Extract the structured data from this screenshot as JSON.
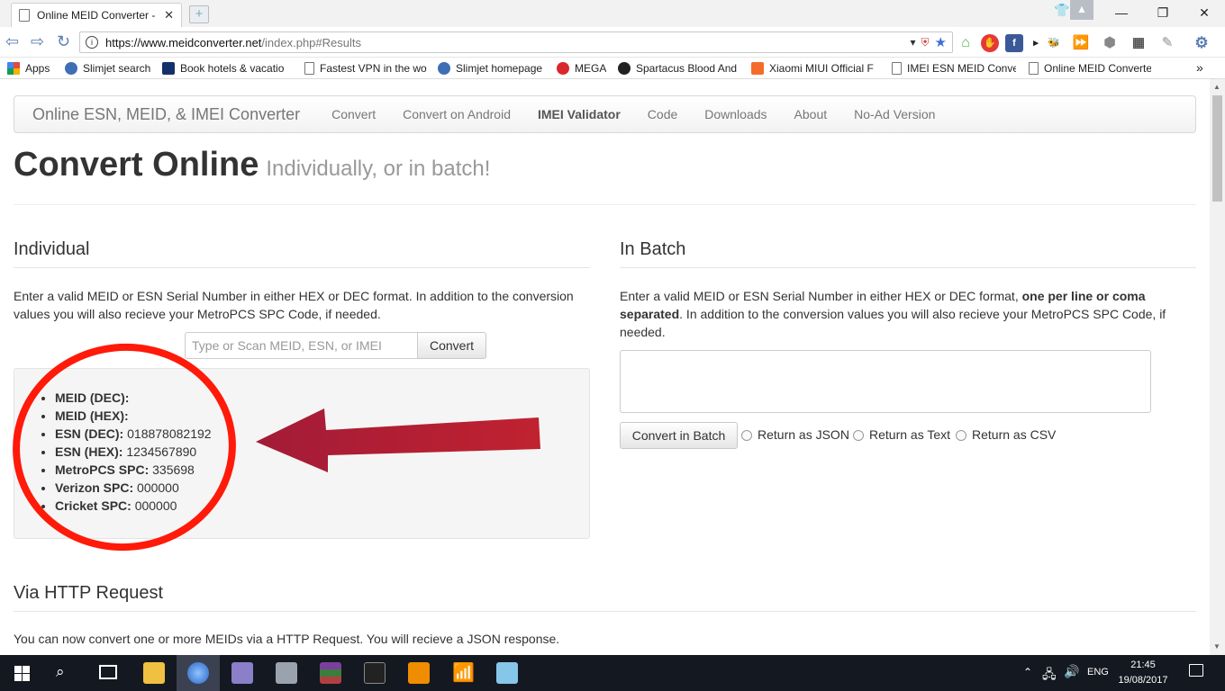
{
  "browser": {
    "tab_title": "Online MEID Converter -",
    "url_host": "https://www.meidconverter.net",
    "url_rest": "/index.php#Results",
    "accent": "#5b7db3"
  },
  "bookmarks": [
    {
      "label": "Apps",
      "color": "#e04a3f"
    },
    {
      "label": "Slimjet search",
      "color": "#3e6fb5"
    },
    {
      "label": "Book hotels & vacatio",
      "color": "#14316b"
    },
    {
      "label": "Fastest VPN in the wo",
      "color": "#ffffff"
    },
    {
      "label": "Slimjet homepage",
      "color": "#3e6fb5"
    },
    {
      "label": "MEGA",
      "color": "#d9272e"
    },
    {
      "label": "Spartacus Blood And",
      "color": "#222222"
    },
    {
      "label": "Xiaomi MIUI Official F",
      "color": "#f56b2a"
    },
    {
      "label": "IMEI ESN MEID Conve",
      "color": "#ffffff"
    },
    {
      "label": "Online MEID Converte",
      "color": "#ffffff"
    }
  ],
  "bookmarks_more": "»",
  "site": {
    "brand": "Online ESN, MEID, & IMEI Converter",
    "nav": [
      "Convert",
      "Convert on Android",
      "IMEI Validator",
      "Code",
      "Downloads",
      "About",
      "No-Ad Version"
    ],
    "nav_active": "IMEI Validator",
    "title": "Convert Online",
    "subtitle": "Individually, or in batch!"
  },
  "individual": {
    "heading": "Individual",
    "description": "Enter a valid MEID or ESN Serial Number in either HEX or DEC format. In addition to the conversion values you will also recieve your MetroPCS SPC Code, if needed.",
    "input_placeholder": "Type or Scan MEID, ESN, or IMEI",
    "convert_label": "Convert",
    "results": [
      {
        "label": "MEID (DEC):",
        "value": ""
      },
      {
        "label": "MEID (HEX):",
        "value": ""
      },
      {
        "label": "ESN (DEC):",
        "value": "018878082192"
      },
      {
        "label": "ESN (HEX):",
        "value": "1234567890"
      },
      {
        "label": "MetroPCS SPC:",
        "value": "335698"
      },
      {
        "label": "Verizon SPC:",
        "value": "000000"
      },
      {
        "label": "Cricket SPC:",
        "value": "000000"
      }
    ]
  },
  "batch": {
    "heading": "In Batch",
    "desc_before": "Enter a valid MEID or ESN Serial Number in either HEX or DEC format,",
    "desc_bold": "one per line or coma separated",
    "desc_after": ". In addition to the conversion values you will also recieve your MetroPCS SPC Code, if needed.",
    "button_label": "Convert in Batch",
    "options": [
      "Return as JSON",
      "Return as Text",
      "Return as CSV"
    ]
  },
  "http": {
    "heading": "Via HTTP Request",
    "description": "You can now convert one or more MEIDs via a HTTP Request. You will recieve a JSON response."
  },
  "annotation_color": "#ff1a0a",
  "arrow_color": "#b21e35",
  "taskbar": {
    "language": "ENG",
    "time": "21:45",
    "date": "19/08/2017"
  }
}
